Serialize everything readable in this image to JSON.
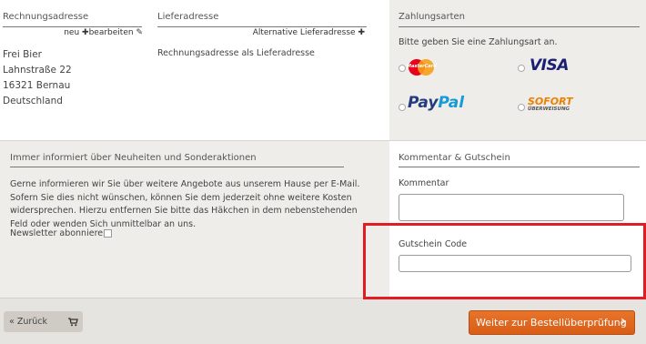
{
  "billing": {
    "title": "Rechnungsadresse",
    "edit_prefix": "neu",
    "edit_label": "bearbeiten",
    "address": [
      "Frei Bier",
      "Lahnstraße 22",
      "16321 Bernau",
      "Deutschland"
    ]
  },
  "delivery": {
    "title": "Lieferadresse",
    "alt_label": "Alternative Lieferadresse",
    "same_text": "Rechnungsadresse als Lieferadresse"
  },
  "payment": {
    "title": "Zahlungsarten",
    "prompt": "Bitte geben Sie eine Zahlungsart an.",
    "options": [
      {
        "name": "MasterCard",
        "logo": "MasterCard"
      },
      {
        "name": "Visa",
        "logo": "VISA"
      },
      {
        "name": "PayPal",
        "logo_a": "Pay",
        "logo_b": "Pal"
      },
      {
        "name": "Sofort Überweisung",
        "logo_top": "SOFORT",
        "logo_bottom": "ÜBERWEISUNG"
      }
    ]
  },
  "newsletter": {
    "title": "Immer informiert über Neuheiten und Sonderaktionen",
    "body": "Gerne informieren wir Sie über weitere Angebote aus unserem Hause per E-Mail. Sofern Sie dies nicht wünschen, können Sie dem jederzeit ohne weitere Kosten widersprechen. Hierzu entfernen Sie bitte das Häkchen in dem nebenstehenden Feld oder wenden Sich unmittelbar an uns.",
    "checkbox_label": "Newsletter abonnieren"
  },
  "comment": {
    "title": "Kommentar & Gutschein",
    "comment_label": "Kommentar",
    "comment_value": "",
    "coupon_label": "Gutschein Code",
    "coupon_value": ""
  },
  "actions": {
    "back_label": "« Zurück",
    "next_label": "Weiter zur Bestellüberprüfung"
  },
  "colors": {
    "highlight_red": "#e31b23",
    "next_button": "#e0691f",
    "sofort_orange": "#ee7f00",
    "visa_blue": "#1a1f71",
    "paypal_dark": "#253b80",
    "paypal_light": "#179bd7"
  },
  "icons": {
    "edit": "pencil-icon",
    "add": "plus-icon",
    "cart": "cart-icon",
    "next": "chevron-right-icon"
  }
}
